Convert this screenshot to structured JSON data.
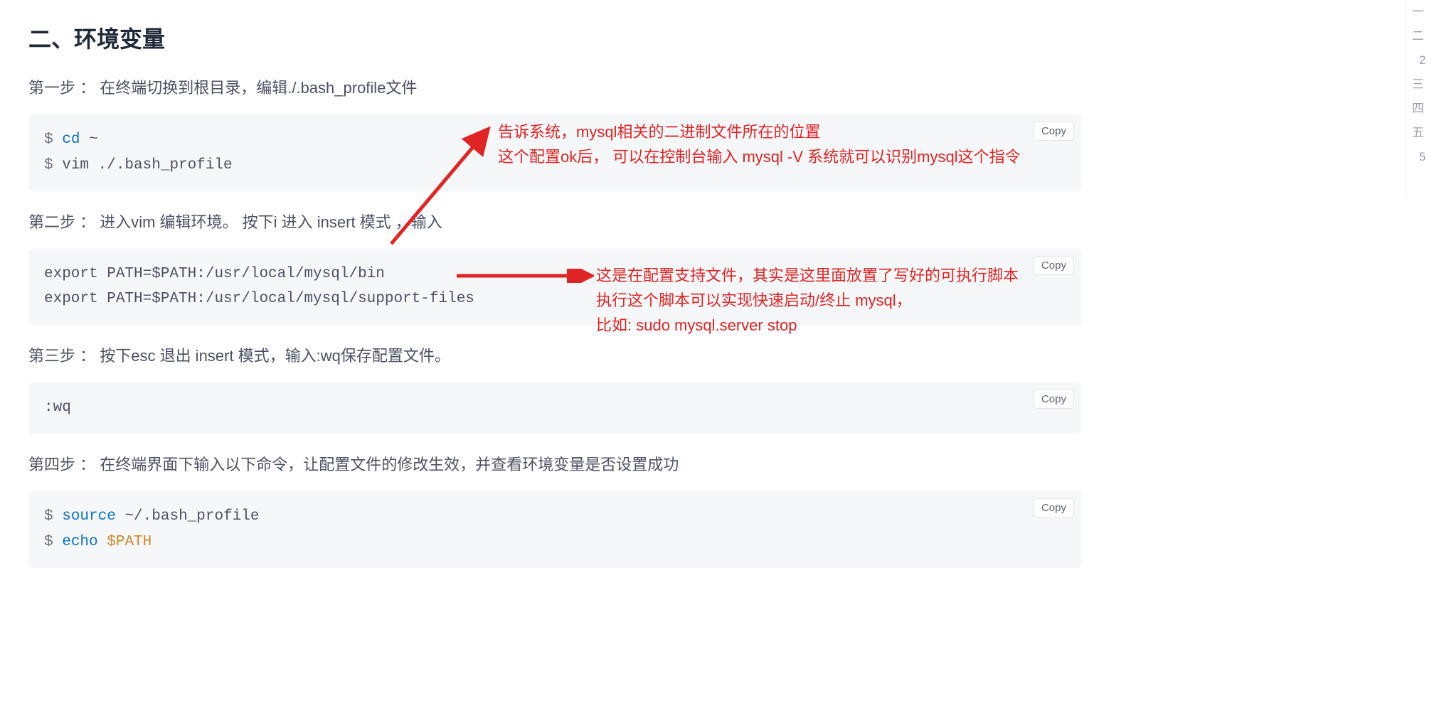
{
  "heading": "二、环境变量",
  "step1": "第一步 ： 在终端切换到根目录，编辑./.bash_profile文件",
  "code1": {
    "prompt1": "$",
    "cmd1": "cd",
    "arg1": "~",
    "prompt2": "$",
    "cmd2": "vim ./.bash_profile"
  },
  "step2": "第二步 ： 进入vim 编辑环境。 按下i 进入 insert 模式 ，输入",
  "code2": {
    "line1": "export PATH=$PATH:/usr/local/mysql/bin",
    "line2": "export PATH=$PATH:/usr/local/mysql/support-files"
  },
  "step3": "第三步 ： 按下esc 退出 insert 模式，输入:wq保存配置文件。",
  "code3": {
    "line1": ":wq"
  },
  "step4": "第四步 ： 在终端界面下输入以下命令，让配置文件的修改生效，并查看环境变量是否设置成功",
  "code4": {
    "prompt1": "$",
    "cmd1": "source",
    "arg1": "~/.bash_profile",
    "prompt2": "$",
    "cmd2": "echo",
    "var2": "$PATH"
  },
  "copy_label": "Copy",
  "annotation1_line1": "告诉系统，mysql相关的二进制文件所在的位置",
  "annotation1_line2": "这个配置ok后， 可以在控制台输入 mysql -V 系统就可以识别mysql这个指令",
  "annotation2_line1": "这是在配置支持文件，其实是这里面放置了写好的可执行脚本",
  "annotation2_line2": "执行这个脚本可以实现快速启动/终止 mysql，",
  "annotation2_line3": "比如: sudo mysql.server stop",
  "toc": {
    "i1": "一",
    "i2": "二",
    "i2s": "2",
    "i3": "三",
    "i4": "四",
    "i5": "五",
    "i5s": "5"
  }
}
